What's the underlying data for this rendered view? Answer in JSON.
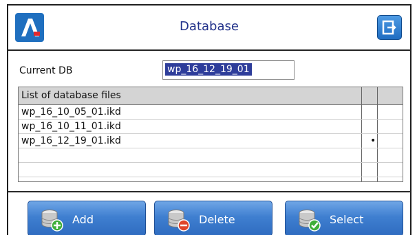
{
  "window": {
    "title": "Database"
  },
  "logo": {
    "letter": "A"
  },
  "icons": {
    "logo": "brand-logo-icon",
    "exit": "exit-icon",
    "add": "database-add-icon",
    "delete": "database-delete-icon",
    "select": "database-select-icon"
  },
  "current_db": {
    "label": "Current DB",
    "value": "wp_16_12_19_01"
  },
  "table": {
    "header": "List of database files",
    "rows": [
      {
        "name": "wp_16_10_05_01.ikd",
        "marker": ""
      },
      {
        "name": "wp_16_10_11_01.ikd",
        "marker": ""
      },
      {
        "name": "wp_16_12_19_01.ikd",
        "marker": "•"
      },
      {
        "name": "",
        "marker": ""
      },
      {
        "name": "",
        "marker": ""
      }
    ]
  },
  "buttons": {
    "add": "Add",
    "delete": "Delete",
    "select": "Select"
  },
  "colors": {
    "accent": "#2f6cc0",
    "title": "#21318a",
    "selection": "#2e3d9a",
    "logo_red": "#e0282e"
  }
}
